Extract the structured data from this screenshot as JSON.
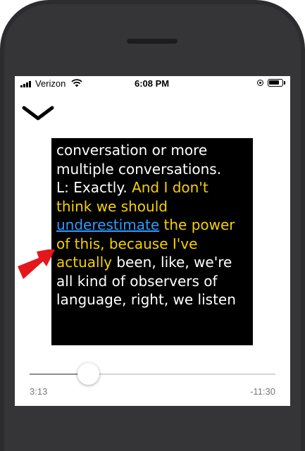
{
  "status_bar": {
    "carrier": "Verizon",
    "time": "6:08 PM",
    "battery_level": 0.85
  },
  "transcript": {
    "segments": [
      {
        "text": "conversation or more\nmultiple conversations.\nL:  Exactly. ",
        "style": "normal"
      },
      {
        "text": "And I don't\nthink we should\n",
        "style": "highlighted"
      },
      {
        "text": "underestimate",
        "style": "lookup-link"
      },
      {
        "text": " the power\nof this, because I've\nactually",
        "style": "highlighted"
      },
      {
        "text": " been, like, we're\nall kind of observers of\nlanguage, right, we listen",
        "style": "normal"
      }
    ]
  },
  "player": {
    "elapsed": "3:13",
    "remaining": "-11:30",
    "progress": 0.24
  },
  "colors": {
    "highlight": "#f5d100",
    "link": "#2f9bff",
    "arrow": "#e3171c",
    "transcript_bg": "#000000"
  },
  "icons": {
    "close": "chevron-down-icon",
    "pointer": "red-arrow-icon"
  }
}
